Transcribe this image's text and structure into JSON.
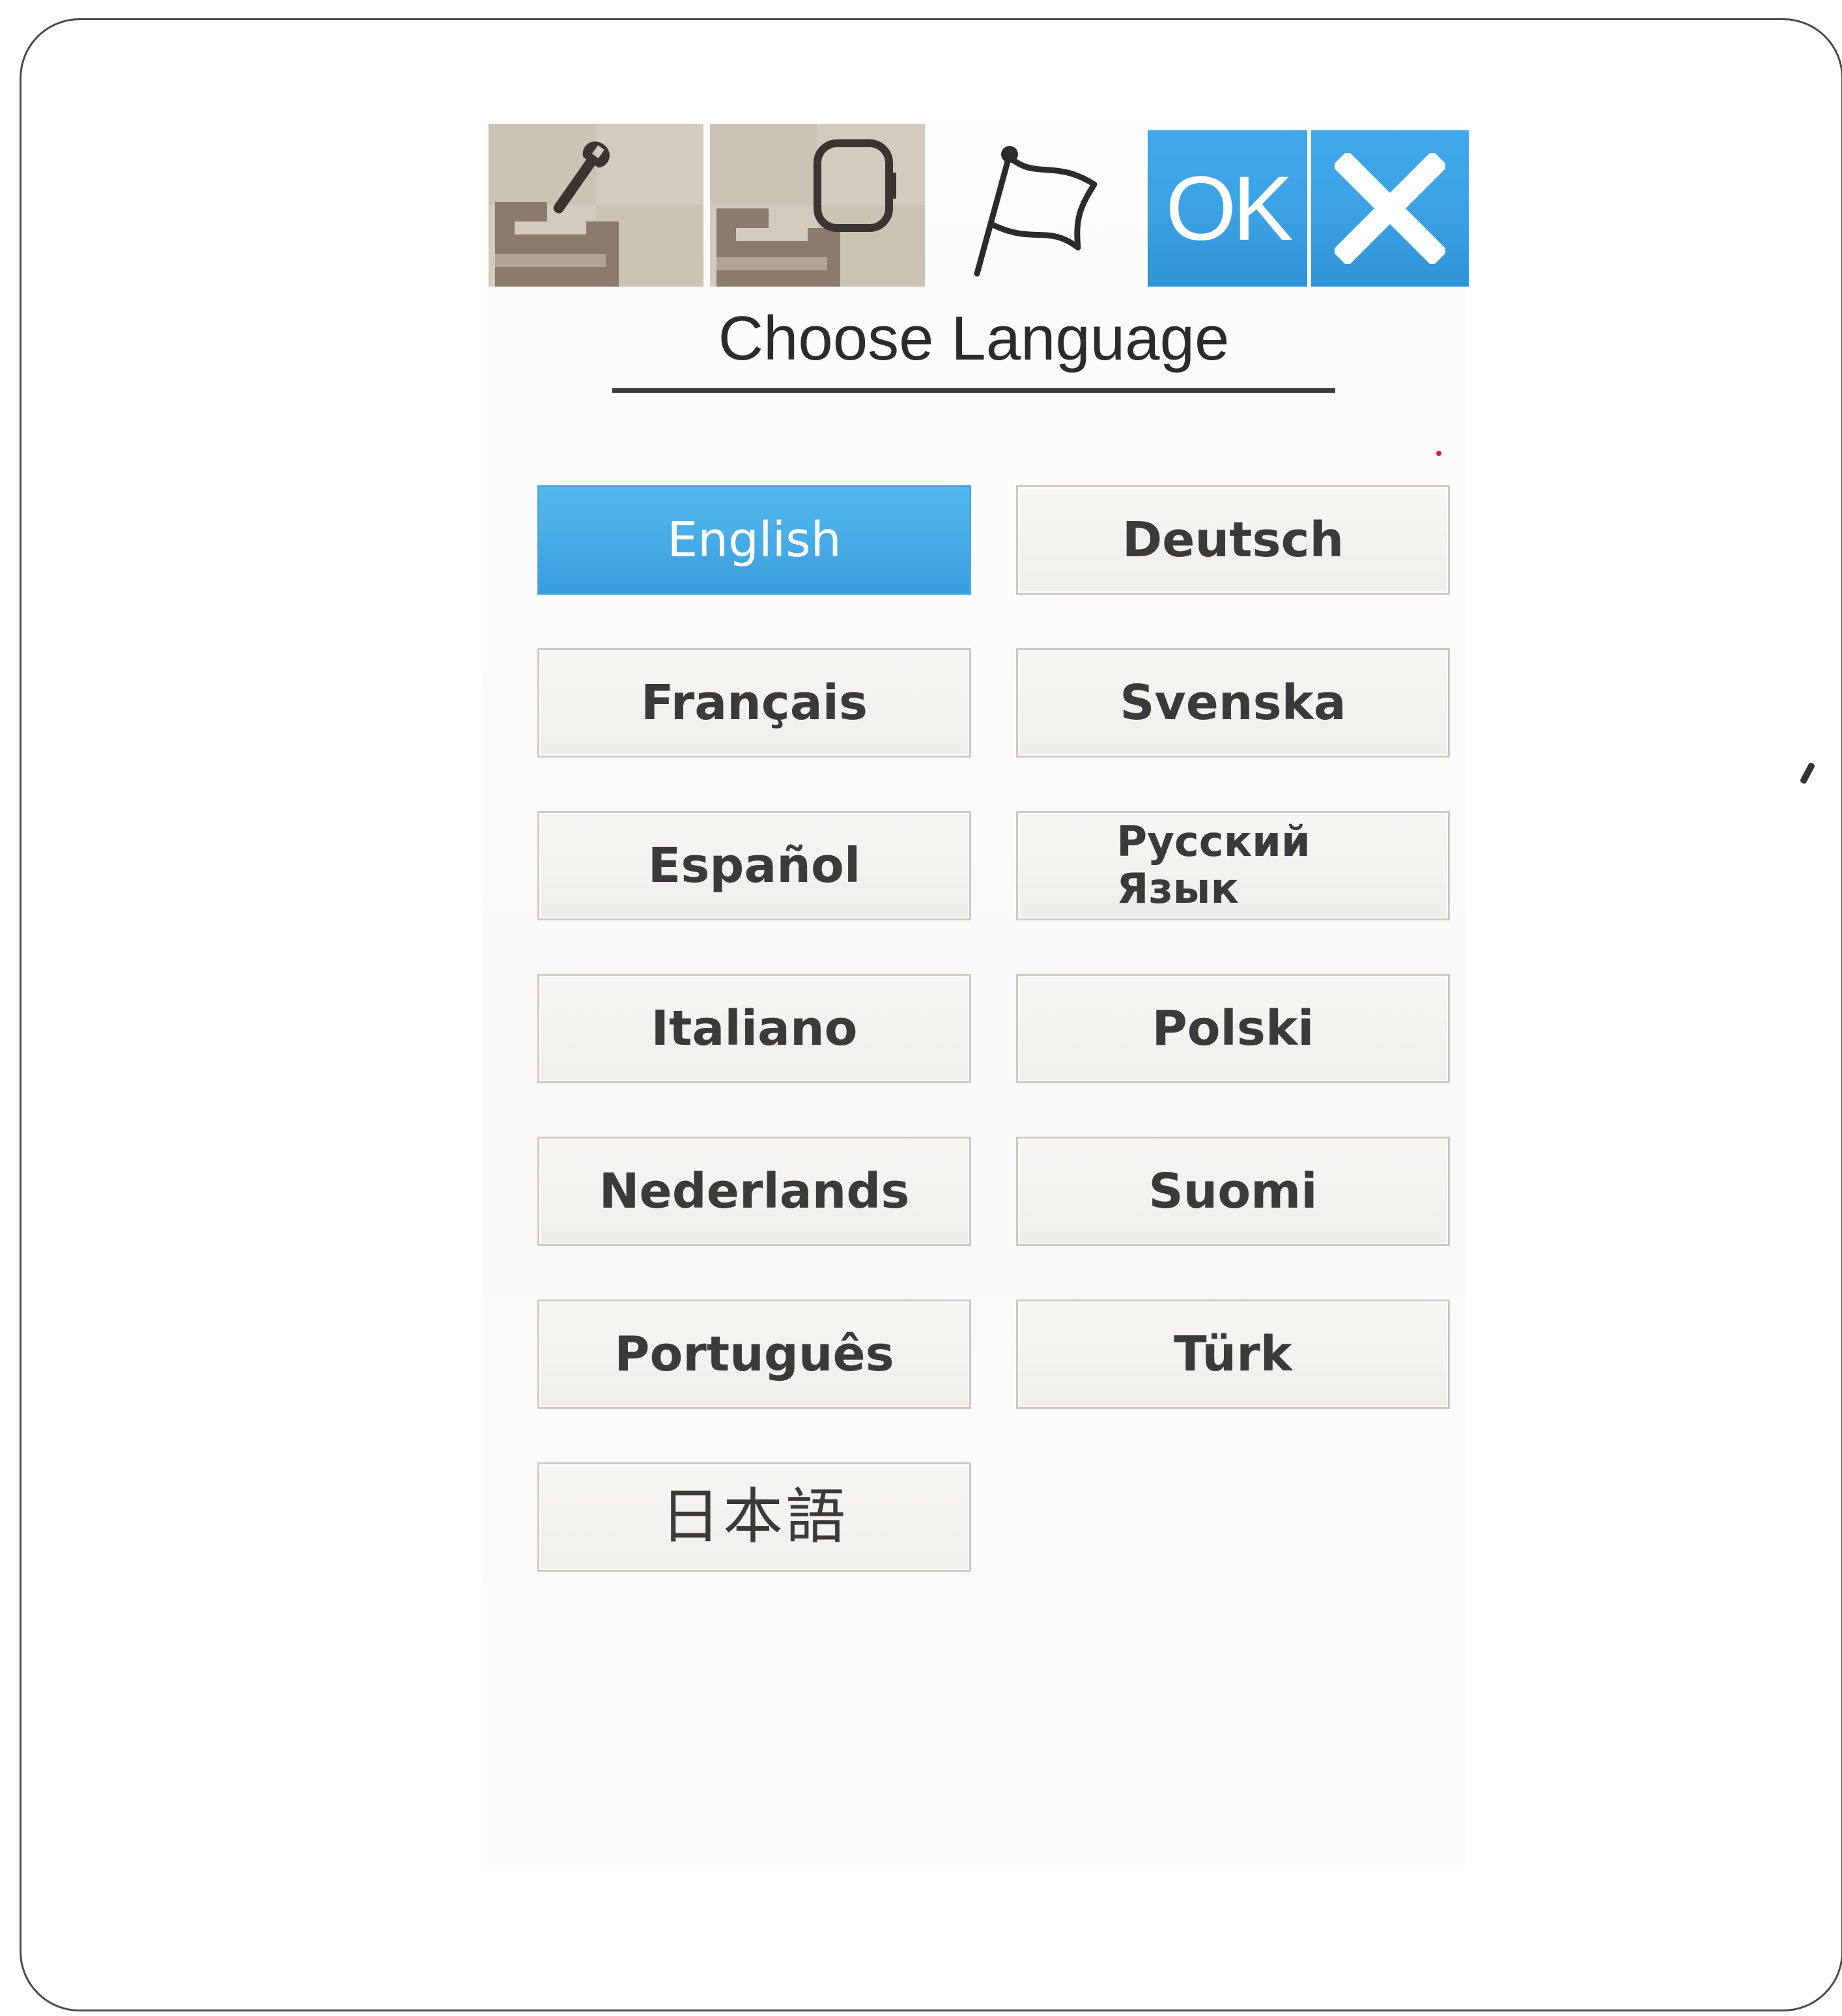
{
  "toolbar": {
    "tiles": [
      {
        "icon": "machine-settings-wrench-icon"
      },
      {
        "icon": "embroidery-hoop-settings-icon"
      }
    ],
    "current_icon": "language-flag-icon",
    "ok_label": "OK",
    "cancel_icon": "close-x-icon",
    "accent_color": "#3ba1e4"
  },
  "title": "Choose Language",
  "languages": [
    {
      "label": "English",
      "selected": true
    },
    {
      "label": "Deutsch",
      "selected": false
    },
    {
      "label": "Français",
      "selected": false
    },
    {
      "label": "Svenska",
      "selected": false
    },
    {
      "label": "Español",
      "selected": false
    },
    {
      "label": "Русский\nЯзык",
      "selected": false
    },
    {
      "label": "Italiano",
      "selected": false
    },
    {
      "label": "Polski",
      "selected": false
    },
    {
      "label": "Nederlands",
      "selected": false
    },
    {
      "label": "Suomi",
      "selected": false
    },
    {
      "label": "Português",
      "selected": false
    },
    {
      "label": "Türk",
      "selected": false
    },
    {
      "label": "日本語",
      "selected": false
    }
  ]
}
